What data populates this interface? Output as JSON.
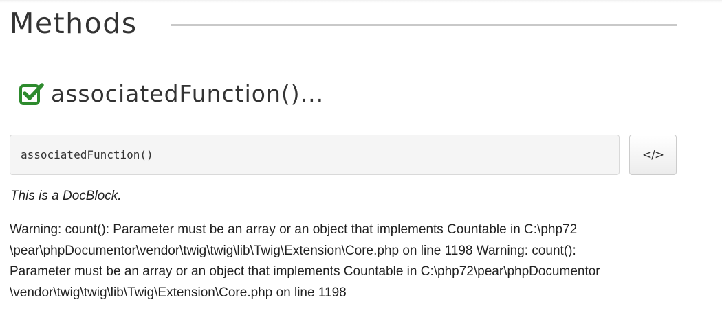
{
  "section": {
    "title": "Methods"
  },
  "method": {
    "name": "associatedFunction()...",
    "icon": "check-square-icon",
    "icon_color": "#2e8b2e",
    "signature": "associatedFunction()",
    "source_button_label": "</>",
    "docblock": "This is a DocBlock."
  },
  "warnings": [
    "Warning: count(): Parameter must be an array or an object that implements Countable in C:\\php72",
    "\\pear\\phpDocumentor\\vendor\\twig\\twig\\lib\\Twig\\Extension\\Core.php on line 1198 Warning: count():",
    "Parameter must be an array or an object that implements Countable in C:\\php72\\pear\\phpDocumentor",
    "\\vendor\\twig\\twig\\lib\\Twig\\Extension\\Core.php on line 1198"
  ]
}
